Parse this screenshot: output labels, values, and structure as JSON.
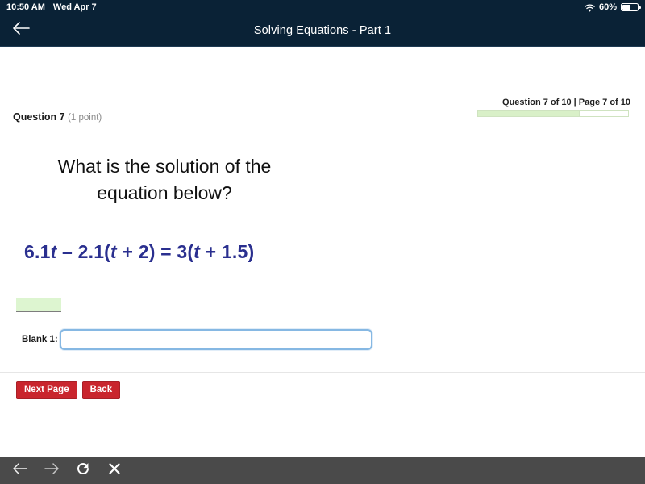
{
  "status_bar": {
    "time": "10:50 AM",
    "date": "Wed Apr 7",
    "wifi_icon": "wifi-icon",
    "battery_percent": "60%",
    "battery_icon": "battery-icon"
  },
  "nav_bar": {
    "back_icon": "arrow-left-icon",
    "title": "Solving Equations - Part 1"
  },
  "question": {
    "label": "Question 7",
    "points": "(1 point)",
    "progress_text": "Question 7 | Page 7 of 10",
    "progress_question_text": "Question 7 of 10",
    "progress_separator": " | ",
    "progress_page_text": "Page 7 of 10",
    "progress_percent": 68,
    "prompt_line1": "What is the solution of the",
    "prompt_line2": "equation below?",
    "equation_text": "6.1t – 2.1(t + 2) = 3(t + 1.5)",
    "equation_parts": {
      "a": "6.1",
      "var1": "t",
      "b": " – 2.1(",
      "var2": "t",
      "c": " + 2) = 3(",
      "var3": "t",
      "d": " + 1.5)"
    }
  },
  "answer": {
    "blank_label": "Blank 1:",
    "blank_value": "",
    "blank_placeholder": ""
  },
  "actions": {
    "next_label": "Next Page",
    "back_label": "Back"
  },
  "bottom_toolbar": {
    "back_icon": "arrow-left-icon",
    "forward_icon": "arrow-right-icon",
    "reload_icon": "reload-icon",
    "close_icon": "close-icon"
  },
  "colors": {
    "navbar": "#0a2236",
    "equation": "#2a2f8f",
    "button": "#c9252d",
    "progress_fill": "#d9f0c8",
    "input_border": "#86b8e3",
    "toolbar": "#4a4a4a",
    "highlight": "#ddf5d0"
  }
}
